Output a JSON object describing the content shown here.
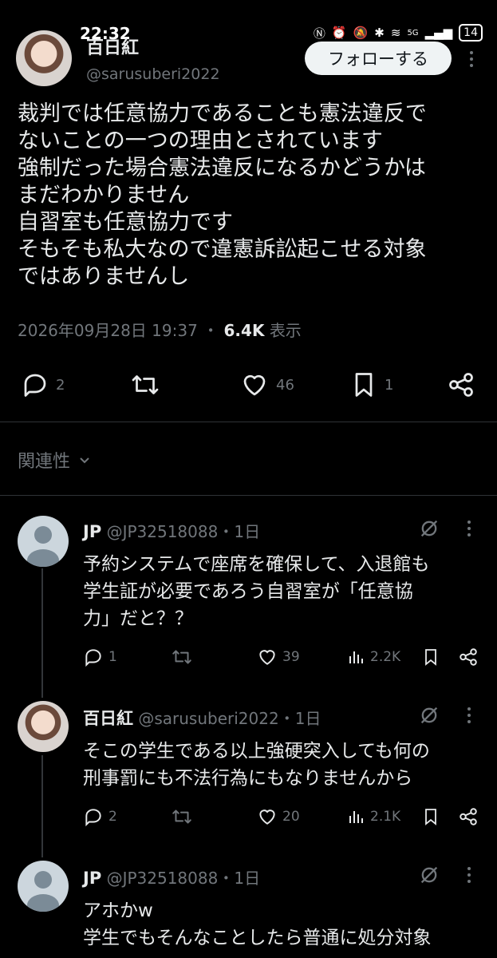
{
  "status_bar": {
    "time": "22:32",
    "battery": "14",
    "network": "5G"
  },
  "tweet": {
    "author_name": "百日紅",
    "author_handle": "@sarusuberi2022",
    "follow_label": "フォローする",
    "lines": [
      "裁判では任意協力であることも憲法違反で",
      "ないことの一つの理由とされています",
      "強制だった場合憲法違反になるかどうかは",
      "まだわかりません",
      "自習室も任意協力です",
      "そもそも私大なので違憲訴訟起こせる対象",
      "ではありませんし"
    ],
    "timestamp": "2026年09月28日 19:37",
    "separator": "・",
    "views": "6.4K",
    "views_label": "表示",
    "replies": "2",
    "likes": "46",
    "bookmarks": "1"
  },
  "related": {
    "label": "関連性"
  },
  "replies": [
    {
      "name": "JP",
      "handle": "@JP32518088",
      "time": "・1日",
      "lines": [
        "予約システムで座席を確保して、入退館も",
        "学生証が必要であろう自習室が「任意協",
        "力」だと？？"
      ],
      "replies": "1",
      "likes": "39",
      "views": "2.2K"
    },
    {
      "name": "百日紅",
      "handle": "@sarusuberi2022",
      "time": "・1日",
      "lines": [
        "そこの学生である以上強硬突入しても何の",
        "刑事罰にも不法行為にもなりませんから"
      ],
      "replies": "2",
      "likes": "20",
      "views": "2.1K"
    },
    {
      "name": "JP",
      "handle": "@JP32518088",
      "time": "・1日",
      "lines": [
        "アホかw",
        "学生でもそんなことしたら普通に処分対象"
      ]
    }
  ],
  "colors": {
    "background": "#000000",
    "text": "#e7e9ea",
    "muted": "#71767b",
    "follow_button": "#eff3f4"
  }
}
